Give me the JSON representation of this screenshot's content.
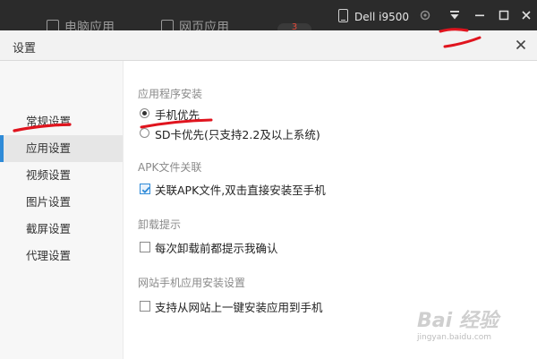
{
  "topbar": {
    "faded_tab_1": "电脑应用",
    "faded_tab_2": "网页应用",
    "badge": "3",
    "device_name": "Dell i9500"
  },
  "dialog": {
    "title": "设置"
  },
  "sidebar": {
    "items": [
      {
        "label": "常规设置"
      },
      {
        "label": "应用设置",
        "active": true
      },
      {
        "label": "视频设置"
      },
      {
        "label": "图片设置"
      },
      {
        "label": "截屏设置"
      },
      {
        "label": "代理设置"
      }
    ]
  },
  "sections": {
    "install": {
      "title": "应用程序安装",
      "options": [
        {
          "label": "手机优先",
          "checked": true
        },
        {
          "label": "SD卡优先(只支持2.2及以上系统)",
          "checked": false
        }
      ]
    },
    "apk": {
      "title": "APK文件关联",
      "option": {
        "label": "关联APK文件,双击直接安装至手机",
        "checked": true
      }
    },
    "uninstall": {
      "title": "卸载提示",
      "option": {
        "label": "每次卸载前都提示我确认",
        "checked": false
      }
    },
    "web": {
      "title": "网站手机应用安装设置",
      "option": {
        "label": "支持从网站上一键安装应用到手机",
        "checked": false
      }
    }
  },
  "watermark": {
    "brand": "Bai 经验",
    "sub": "jingyan.baidu.com"
  },
  "colors": {
    "accent": "#2f8bd8",
    "annotation": "#e0141e",
    "topbar": "#2b2b2b"
  }
}
